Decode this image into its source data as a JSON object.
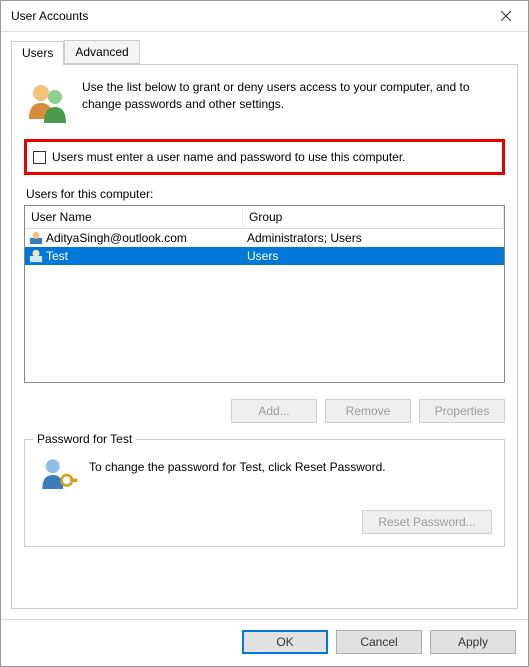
{
  "window": {
    "title": "User Accounts"
  },
  "tabs": {
    "users": "Users",
    "advanced": "Advanced"
  },
  "intro": {
    "text": "Use the list below to grant or deny users access to your computer, and to change passwords and other settings."
  },
  "checkbox": {
    "label": "Users must enter a user name and password to use this computer.",
    "checked": false
  },
  "usersSection": {
    "label": "Users for this computer:",
    "columns": {
      "user": "User Name",
      "group": "Group"
    },
    "rows": [
      {
        "user": "AdityaSingh@outlook.com",
        "group": "Administrators; Users",
        "selected": false
      },
      {
        "user": "Test",
        "group": "Users",
        "selected": true
      }
    ]
  },
  "buttons": {
    "add": "Add...",
    "remove": "Remove",
    "properties": "Properties",
    "resetPassword": "Reset Password...",
    "ok": "OK",
    "cancel": "Cancel",
    "apply": "Apply"
  },
  "passwordBox": {
    "title": "Password for Test",
    "text": "To change the password for Test, click Reset Password."
  }
}
